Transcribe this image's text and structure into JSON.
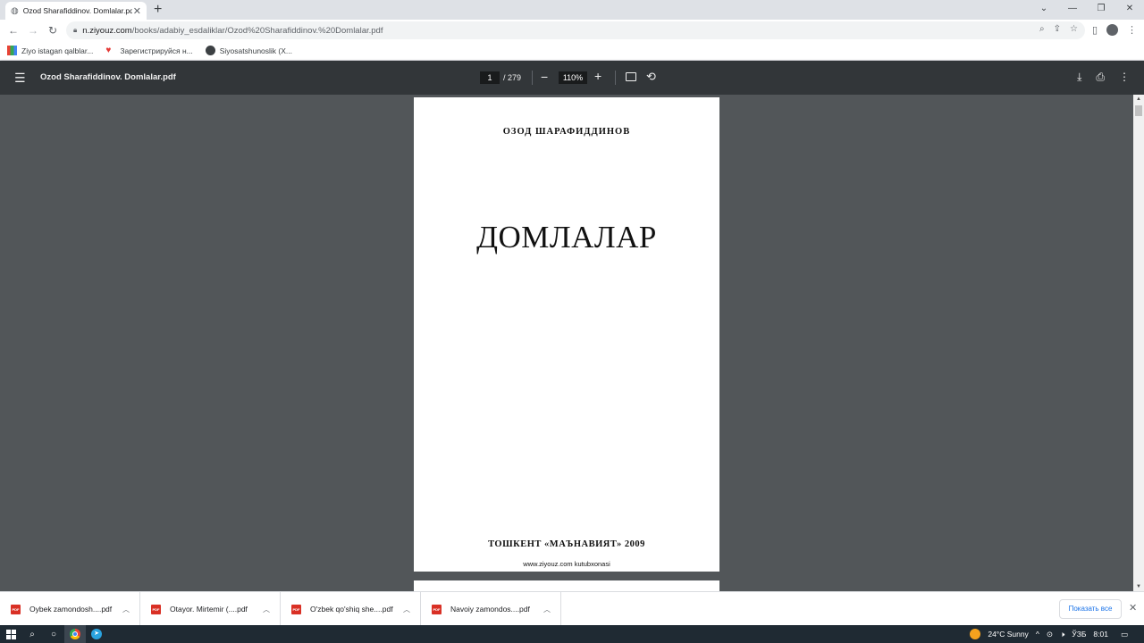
{
  "browser": {
    "tab_title": "Ozod Sharafiddinov. Domlalar.pdf",
    "url_host": "n.ziyouz.com",
    "url_path": "/books/adabiy_esdaliklar/Ozod%20Sharafiddinov.%20Domlalar.pdf",
    "bookmarks": [
      {
        "label": "Ziyo istagan qalblar..."
      },
      {
        "label": "Зарегистрируйся н..."
      },
      {
        "label": "Siyosatshunoslik (X..."
      }
    ]
  },
  "pdf_toolbar": {
    "title": "Ozod Sharafiddinov. Domlalar.pdf",
    "page_current": "1",
    "page_total": "/ 279",
    "zoom": "110%"
  },
  "page": {
    "author": "ОЗОД ШАРАФИДДИНОВ",
    "title": "ДОМЛАЛАР",
    "publisher": "ТОШКЕНТ «МАЪНАВИЯТ» 2009",
    "website": "www.ziyouz.com kutubxonasi"
  },
  "downloads": {
    "items": [
      {
        "name": "Oybek zamondosh....pdf"
      },
      {
        "name": "Otayor. Mirtemir (....pdf"
      },
      {
        "name": "O'zbek qo'shiq she....pdf"
      },
      {
        "name": "Navoiy zamondos....pdf"
      }
    ],
    "show_all": "Показать все"
  },
  "taskbar": {
    "weather": "24°C  Sunny",
    "lang": "ЎЗБ",
    "time": "8:01"
  },
  "colors": {
    "pdf_toolbar_bg": "#323639",
    "viewer_bg": "#525659",
    "taskbar_bg": "#1f2a33",
    "link_blue": "#1a73e8"
  }
}
